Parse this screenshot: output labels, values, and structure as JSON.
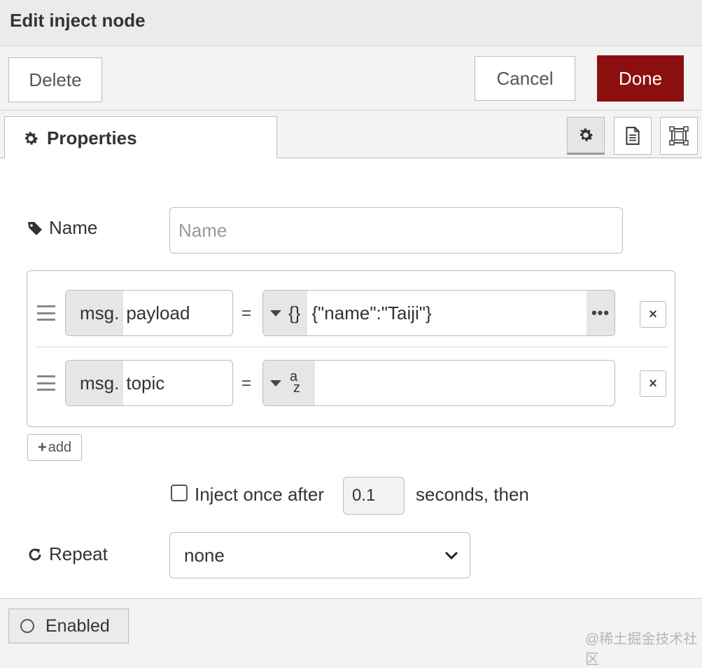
{
  "header": {
    "title": "Edit inject node"
  },
  "toolbar": {
    "delete_label": "Delete",
    "cancel_label": "Cancel",
    "done_label": "Done"
  },
  "tabs": {
    "properties_label": "Properties",
    "icons": [
      "gear-icon",
      "description-icon",
      "appearance-icon"
    ]
  },
  "name_field": {
    "label": "Name",
    "placeholder": "Name",
    "value": ""
  },
  "props": [
    {
      "prefix": "msg.",
      "property": "payload",
      "operator": "=",
      "type_symbol": "{}",
      "value": "{\"name\":\"Taiji\"}",
      "expand_label": "•••",
      "remove_label": "×"
    },
    {
      "prefix": "msg.",
      "property": "topic",
      "operator": "=",
      "type_symbol_a": "a",
      "type_symbol_z": "z",
      "value": "",
      "remove_label": "×"
    }
  ],
  "add_button": {
    "label": "add"
  },
  "inject_once": {
    "label": "Inject once after",
    "delay": "0.1",
    "suffix": "seconds, then",
    "checked": false
  },
  "repeat": {
    "label": "Repeat",
    "selected": "none"
  },
  "footer": {
    "enabled_label": "Enabled",
    "watermark": "@稀土掘金技术社区"
  },
  "colors": {
    "done_bg": "#8c0f0f",
    "header_bg": "#ebebeb",
    "border": "#bbbbbb"
  }
}
